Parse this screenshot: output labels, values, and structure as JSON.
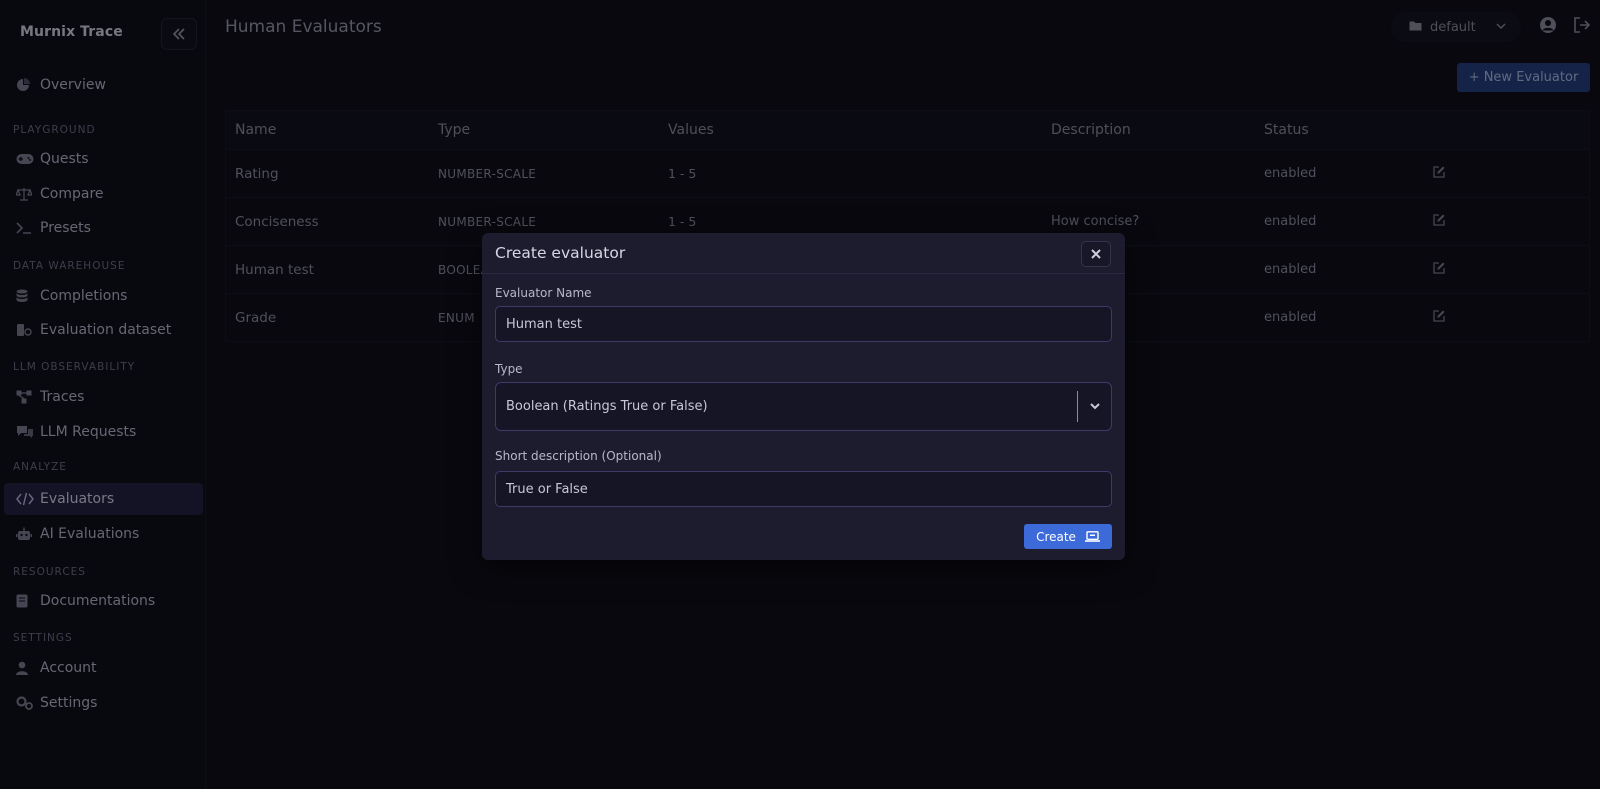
{
  "brand": "Murnix Trace",
  "header": {
    "title": "Human Evaluators",
    "project": "default"
  },
  "nav": {
    "overview": "Overview",
    "sections": {
      "playground": "PLAYGROUND",
      "data_warehouse": "DATA WAREHOUSE",
      "llm_observability": "LLM OBSERVABILITY",
      "analyze": "ANALYZE",
      "resources": "RESOURCES",
      "settings": "SETTINGS"
    },
    "items": {
      "quests": "Quests",
      "compare": "Compare",
      "presets": "Presets",
      "completions": "Completions",
      "evaluation_dataset": "Evaluation dataset",
      "traces": "Traces",
      "llm_requests": "LLM Requests",
      "evaluators": "Evaluators",
      "ai_evaluations": "AI Evaluations",
      "documentations": "Documentations",
      "account": "Account",
      "settings": "Settings"
    }
  },
  "toolbar": {
    "new_evaluator": "+ New Evaluator"
  },
  "table": {
    "columns": [
      "Name",
      "Type",
      "Values",
      "Description",
      "Status"
    ],
    "rows": [
      {
        "name": "Rating",
        "type": "NUMBER-SCALE",
        "values": "1 - 5",
        "description": "",
        "status": "enabled"
      },
      {
        "name": "Conciseness",
        "type": "NUMBER-SCALE",
        "values": "1 - 5",
        "description": "How concise?",
        "status": "enabled"
      },
      {
        "name": "Human test",
        "type": "BOOLEAN",
        "values": "",
        "description": "",
        "status": "enabled"
      },
      {
        "name": "Grade",
        "type": "ENUM",
        "values": "",
        "description": "",
        "status": "enabled"
      }
    ]
  },
  "modal": {
    "title": "Create evaluator",
    "name_label": "Evaluator Name",
    "name_value": "Human test",
    "type_label": "Type",
    "type_value": "Boolean (Ratings True or False)",
    "desc_label": "Short description (Optional)",
    "desc_value": "True or False",
    "create_label": "Create"
  },
  "colors": {
    "accent": "#3c6ad8",
    "active_nav": "#211f3c",
    "modal_bg": "#1d1c2e"
  }
}
